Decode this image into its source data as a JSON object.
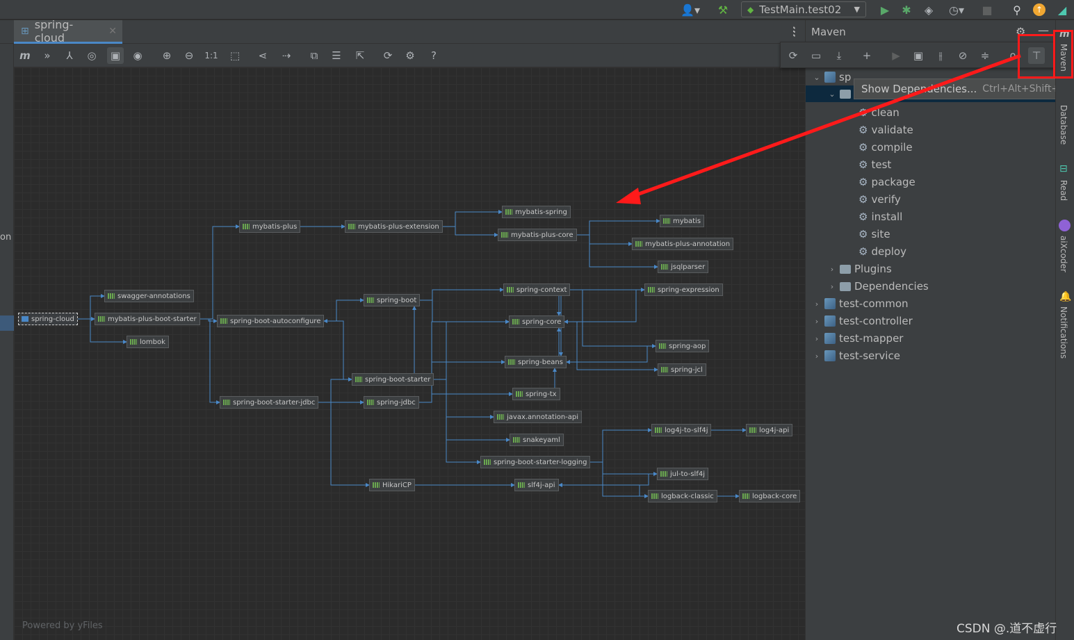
{
  "toolbar": {
    "run_config": "TestMain.test02",
    "icons": [
      "person-icon",
      "hammer-icon",
      "run-icon",
      "debug-icon",
      "coverage-icon",
      "profiler-icon",
      "stop-icon",
      "search-icon",
      "update-icon",
      "toolbox-icon"
    ]
  },
  "editor": {
    "tab_label": "spring-cloud",
    "powered_by": "Powered by yFiles",
    "side_label": "on"
  },
  "diagram_toolbar": {
    "zoom_actual": "1:1",
    "help": "?"
  },
  "graph": {
    "nodes": [
      {
        "id": "spring-cloud",
        "label": "spring-cloud"
      },
      {
        "id": "swagger-annotations",
        "label": "swagger-annotations"
      },
      {
        "id": "mybatis-plus-boot-starter",
        "label": "mybatis-plus-boot-starter"
      },
      {
        "id": "lombok",
        "label": "lombok"
      },
      {
        "id": "mybatis-plus",
        "label": "mybatis-plus"
      },
      {
        "id": "mybatis-plus-extension",
        "label": "mybatis-plus-extension"
      },
      {
        "id": "mybatis-spring",
        "label": "mybatis-spring"
      },
      {
        "id": "mybatis-plus-core",
        "label": "mybatis-plus-core"
      },
      {
        "id": "mybatis",
        "label": "mybatis"
      },
      {
        "id": "mybatis-plus-annotation",
        "label": "mybatis-plus-annotation"
      },
      {
        "id": "jsqlparser",
        "label": "jsqlparser"
      },
      {
        "id": "spring-boot-autoconfigure",
        "label": "spring-boot-autoconfigure"
      },
      {
        "id": "spring-boot",
        "label": "spring-boot"
      },
      {
        "id": "spring-context",
        "label": "spring-context"
      },
      {
        "id": "spring-expression",
        "label": "spring-expression"
      },
      {
        "id": "spring-core",
        "label": "spring-core"
      },
      {
        "id": "spring-aop",
        "label": "spring-aop"
      },
      {
        "id": "spring-beans",
        "label": "spring-beans"
      },
      {
        "id": "spring-jcl",
        "label": "spring-jcl"
      },
      {
        "id": "spring-boot-starter",
        "label": "spring-boot-starter"
      },
      {
        "id": "spring-tx",
        "label": "spring-tx"
      },
      {
        "id": "spring-boot-starter-jdbc",
        "label": "spring-boot-starter-jdbc"
      },
      {
        "id": "spring-jdbc",
        "label": "spring-jdbc"
      },
      {
        "id": "javax.annotation-api",
        "label": "javax.annotation-api"
      },
      {
        "id": "snakeyaml",
        "label": "snakeyaml"
      },
      {
        "id": "spring-boot-starter-logging",
        "label": "spring-boot-starter-logging"
      },
      {
        "id": "log4j-to-slf4j",
        "label": "log4j-to-slf4j"
      },
      {
        "id": "log4j-api",
        "label": "log4j-api"
      },
      {
        "id": "jul-to-slf4j",
        "label": "jul-to-slf4j"
      },
      {
        "id": "HikariCP",
        "label": "HikariCP"
      },
      {
        "id": "slf4j-api",
        "label": "slf4j-api"
      },
      {
        "id": "logback-classic",
        "label": "logback-classic"
      },
      {
        "id": "logback-core",
        "label": "logback-core"
      }
    ],
    "edges": [
      [
        "spring-cloud",
        "swagger-annotations"
      ],
      [
        "spring-cloud",
        "mybatis-plus-boot-starter"
      ],
      [
        "spring-cloud",
        "lombok"
      ],
      [
        "mybatis-plus-boot-starter",
        "mybatis-plus"
      ],
      [
        "mybatis-plus-boot-starter",
        "spring-boot-autoconfigure"
      ],
      [
        "mybatis-plus-boot-starter",
        "spring-boot-starter-jdbc"
      ],
      [
        "mybatis-plus",
        "mybatis-plus-extension"
      ],
      [
        "mybatis-plus-extension",
        "mybatis-spring"
      ],
      [
        "mybatis-plus-extension",
        "mybatis-plus-core"
      ],
      [
        "mybatis-plus-core",
        "mybatis"
      ],
      [
        "mybatis-plus-core",
        "mybatis-plus-annotation"
      ],
      [
        "mybatis-plus-core",
        "jsqlparser"
      ],
      [
        "spring-boot-autoconfigure",
        "spring-boot"
      ],
      [
        "spring-boot",
        "spring-context"
      ],
      [
        "spring-boot",
        "spring-core"
      ],
      [
        "spring-context",
        "spring-expression"
      ],
      [
        "spring-context",
        "spring-core"
      ],
      [
        "spring-context",
        "spring-aop"
      ],
      [
        "spring-context",
        "spring-beans"
      ],
      [
        "spring-core",
        "spring-jcl"
      ],
      [
        "spring-beans",
        "spring-core"
      ],
      [
        "spring-aop",
        "spring-beans"
      ],
      [
        "spring-expression",
        "spring-core"
      ],
      [
        "spring-boot-starter",
        "spring-boot"
      ],
      [
        "spring-boot-starter",
        "spring-boot-autoconfigure"
      ],
      [
        "spring-boot-starter",
        "spring-core"
      ],
      [
        "spring-boot-starter",
        "javax.annotation-api"
      ],
      [
        "spring-boot-starter",
        "snakeyaml"
      ],
      [
        "spring-boot-starter",
        "spring-boot-starter-logging"
      ],
      [
        "spring-boot-starter-jdbc",
        "spring-boot-starter"
      ],
      [
        "spring-boot-starter-jdbc",
        "spring-jdbc"
      ],
      [
        "spring-boot-starter-jdbc",
        "HikariCP"
      ],
      [
        "spring-jdbc",
        "spring-beans"
      ],
      [
        "spring-jdbc",
        "spring-core"
      ],
      [
        "spring-jdbc",
        "spring-tx"
      ],
      [
        "spring-tx",
        "spring-beans"
      ],
      [
        "spring-boot-starter-logging",
        "log4j-to-slf4j"
      ],
      [
        "spring-boot-starter-logging",
        "jul-to-slf4j"
      ],
      [
        "spring-boot-starter-logging",
        "logback-classic"
      ],
      [
        "log4j-to-slf4j",
        "log4j-api"
      ],
      [
        "HikariCP",
        "slf4j-api"
      ],
      [
        "jul-to-slf4j",
        "slf4j-api"
      ],
      [
        "logback-classic",
        "logback-core"
      ],
      [
        "logback-classic",
        "slf4j-api"
      ]
    ]
  },
  "maven": {
    "title": "Maven",
    "tooltip_label": "Show Dependencies...",
    "tooltip_shortcut": "Ctrl+Alt+Shift+U",
    "project_partial": "sp",
    "lifecycle": [
      "clean",
      "validate",
      "compile",
      "test",
      "package",
      "verify",
      "install",
      "site",
      "deploy"
    ],
    "plugins": "Plugins",
    "dependencies": "Dependencies",
    "modules": [
      "test-common",
      "test-controller",
      "test-mapper",
      "test-service"
    ]
  },
  "side_tabs": [
    "Maven",
    "Database",
    "Read",
    "aiXcoder",
    "Notifications"
  ],
  "watermark": "CSDN @.道不虚行",
  "colors": {
    "accent": "#4a88c7",
    "edge": "#4a88c7",
    "annotation_red": "#ff1a1a"
  }
}
